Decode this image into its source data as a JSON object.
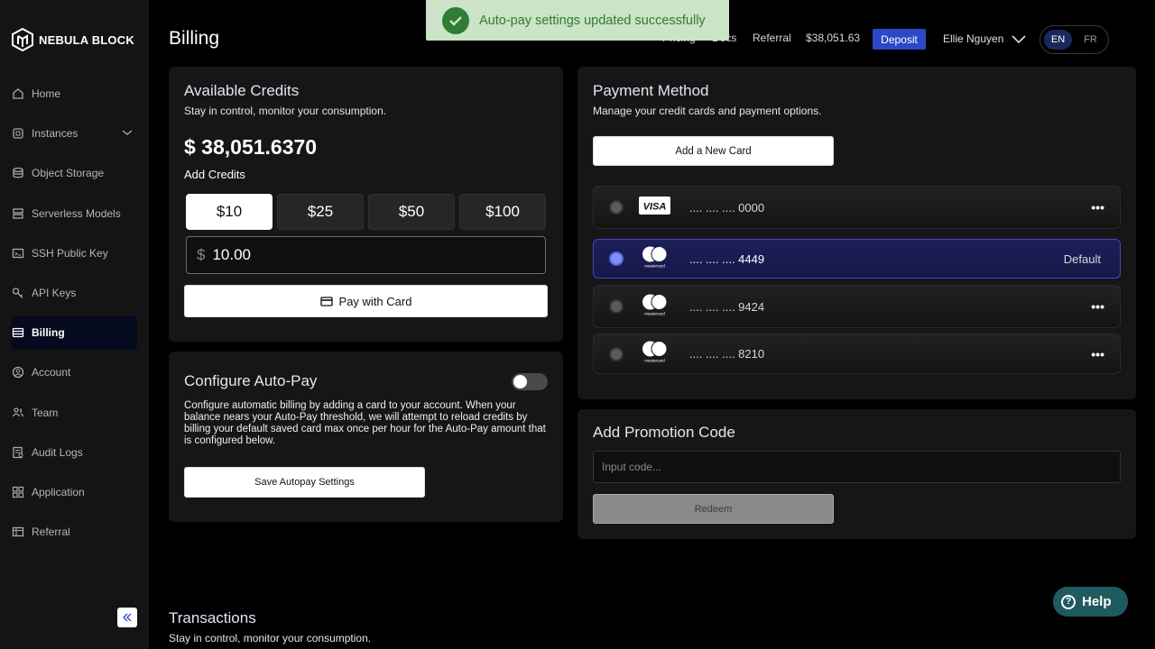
{
  "brand": {
    "name": "NEBULA BLOCK"
  },
  "sidebar": {
    "items": [
      {
        "label": "Home",
        "icon": "home-icon"
      },
      {
        "label": "Instances",
        "icon": "cpu-icon"
      },
      {
        "label": "Object Storage",
        "icon": "database-icon"
      },
      {
        "label": "Serverless Models",
        "icon": "server-icon"
      },
      {
        "label": "SSH Public Key",
        "icon": "terminal-icon"
      },
      {
        "label": "API Keys",
        "icon": "key-icon"
      },
      {
        "label": "Billing",
        "icon": "billing-icon",
        "active": true
      },
      {
        "label": "Account",
        "icon": "user-circle-icon"
      },
      {
        "label": "Team",
        "icon": "team-icon"
      },
      {
        "label": "Audit Logs",
        "icon": "audit-icon"
      },
      {
        "label": "Application",
        "icon": "grid-icon"
      },
      {
        "label": "Referral",
        "icon": "referral-icon"
      }
    ]
  },
  "header": {
    "title": "Billing",
    "nav": {
      "pricing": "Pricing",
      "docs": "Docs",
      "referral": "Referral",
      "balance": "$38,051.63"
    },
    "deposit_label": "Deposit",
    "user_name": "Ellie Nguyen",
    "lang": {
      "en": "EN",
      "fr": "FR",
      "selected": "EN"
    }
  },
  "toast": {
    "message": "Auto-pay settings updated successfully"
  },
  "credits": {
    "title": "Available Credits",
    "subtitle": "Stay in control, monitor your consumption.",
    "balance": "$ 38,051.6370",
    "add_label": "Add Credits",
    "amounts": [
      "$10",
      "$25",
      "$50",
      "$100"
    ],
    "selected_amount": "$10",
    "currency_symbol": "$",
    "amount_value": "10.00",
    "pay_button": "Pay with Card"
  },
  "autopay": {
    "title": "Configure Auto-Pay",
    "enabled": false,
    "description": "Configure automatic billing by adding a card to your account. When your balance nears your Auto-Pay threshold, we will attempt to reload credits by billing your default saved card max once per hour for the Auto-Pay amount that is configured below.",
    "save_button": "Save Autopay Settings"
  },
  "payment": {
    "title": "Payment Method",
    "subtitle": "Manage your credit cards and payment options.",
    "add_card_button": "Add a New Card",
    "cards": [
      {
        "brand": "VISA",
        "number": ".... .... .... 0000",
        "default": false
      },
      {
        "brand": "mastercard",
        "number": ".... .... .... 4449",
        "default": true,
        "default_label": "Default"
      },
      {
        "brand": "mastercard",
        "number": ".... .... .... 9424",
        "default": false
      },
      {
        "brand": "mastercard",
        "number": ".... .... .... 8210",
        "default": false
      }
    ]
  },
  "promo": {
    "title": "Add Promotion Code",
    "placeholder": "Input code...",
    "redeem_button": "Redeem"
  },
  "transactions": {
    "title": "Transactions",
    "subtitle": "Stay in control, monitor your consumption."
  },
  "help": {
    "label": "Help"
  },
  "colors": {
    "accent": "#2b48c8",
    "success": "#2e7d32",
    "toast_bg": "#cbe3c6",
    "help_bg": "#1f5a5f"
  }
}
